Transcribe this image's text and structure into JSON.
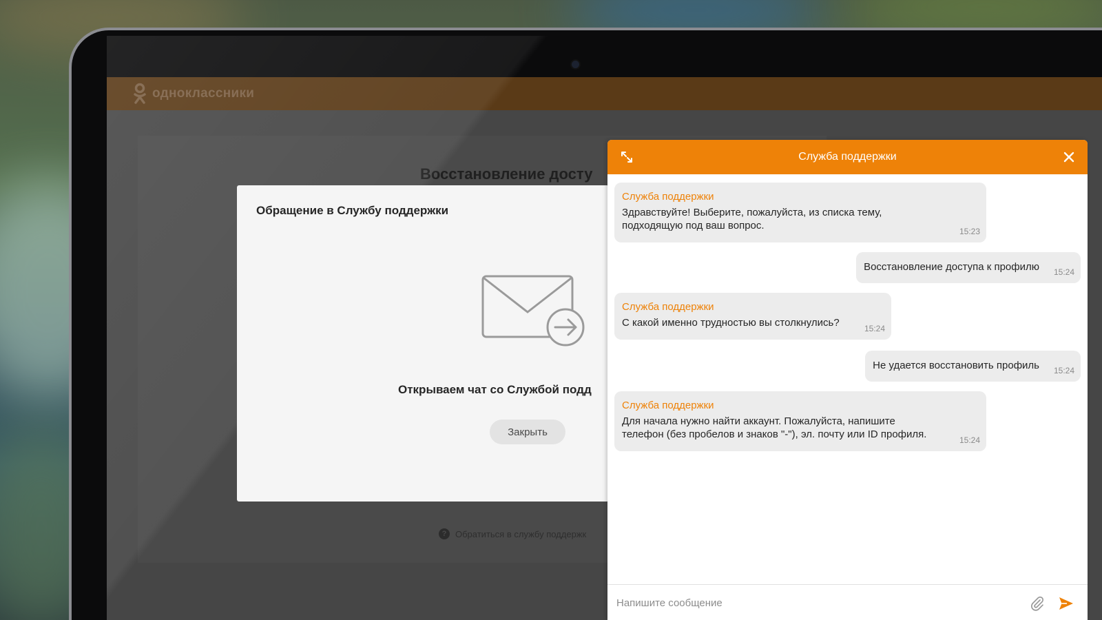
{
  "site": {
    "name": "одноклассники",
    "page_heading": "Восстановление досту",
    "help_link": "Обратиться в службу поддержк"
  },
  "modal": {
    "title": "Обращение в Службу поддержки",
    "status": "Открываем чат со Службой подд",
    "close_label": "Закрыть"
  },
  "chat": {
    "title": "Служба поддержки",
    "messages": [
      {
        "direction": "incoming",
        "sender": "Служба поддержки",
        "text": "Здравствуйте! Выберите, пожалуйста, из списка тему, подходящую под ваш вопрос.",
        "time": "15:23"
      },
      {
        "direction": "outgoing",
        "text": "Восстановление доступа к профилю",
        "time": "15:24"
      },
      {
        "direction": "incoming",
        "sender": "Служба поддержки",
        "text": "С какой именно трудностью вы столкнулись?",
        "time": "15:24"
      },
      {
        "direction": "outgoing",
        "text": "Не удается восстановить профиль",
        "time": "15:24"
      },
      {
        "direction": "incoming",
        "sender": "Служба поддержки",
        "text": "Для начала нужно найти аккаунт. Пожалуйста, напишите телефон (без пробелов и знаков \"-\"), эл. почту или ID профиля.",
        "time": "15:24"
      }
    ],
    "input": {
      "value": "",
      "placeholder": "Напишите сообщение"
    },
    "icons": {
      "expand": "expand-icon",
      "close": "close-icon",
      "attach": "paperclip-icon",
      "send": "send-icon"
    }
  },
  "colors": {
    "accent": "#ee8208",
    "bubble": "#ececec",
    "modal_bg": "#f5f5f5"
  }
}
